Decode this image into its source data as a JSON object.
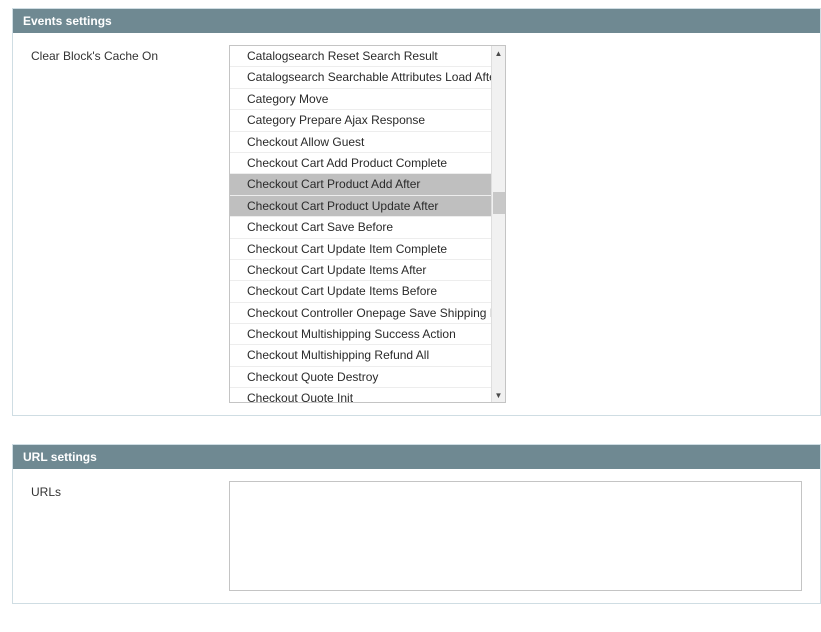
{
  "sections": {
    "events": {
      "title": "Events settings",
      "field_label": "Clear Block's Cache On",
      "items": [
        {
          "label": "Catalogsearch Reset Search Result",
          "selected": false
        },
        {
          "label": "Catalogsearch Searchable Attributes Load After",
          "selected": false
        },
        {
          "label": "Category Move",
          "selected": false
        },
        {
          "label": "Category Prepare Ajax Response",
          "selected": false
        },
        {
          "label": "Checkout Allow Guest",
          "selected": false
        },
        {
          "label": "Checkout Cart Add Product Complete",
          "selected": false
        },
        {
          "label": "Checkout Cart Product Add After",
          "selected": true
        },
        {
          "label": "Checkout Cart Product Update After",
          "selected": true
        },
        {
          "label": "Checkout Cart Save Before",
          "selected": false
        },
        {
          "label": "Checkout Cart Update Item Complete",
          "selected": false
        },
        {
          "label": "Checkout Cart Update Items After",
          "selected": false
        },
        {
          "label": "Checkout Cart Update Items Before",
          "selected": false
        },
        {
          "label": "Checkout Controller Onepage Save Shipping Method",
          "selected": false
        },
        {
          "label": "Checkout Multishipping Success Action",
          "selected": false
        },
        {
          "label": "Checkout Multishipping Refund All",
          "selected": false
        },
        {
          "label": "Checkout Quote Destroy",
          "selected": false
        },
        {
          "label": "Checkout Quote Init",
          "selected": false
        }
      ]
    },
    "url": {
      "title": "URL settings",
      "field_label": "URLs",
      "placeholder": ""
    }
  },
  "colors": {
    "header_bg": "#6f8992",
    "selected_bg": "#bfbfbf"
  }
}
